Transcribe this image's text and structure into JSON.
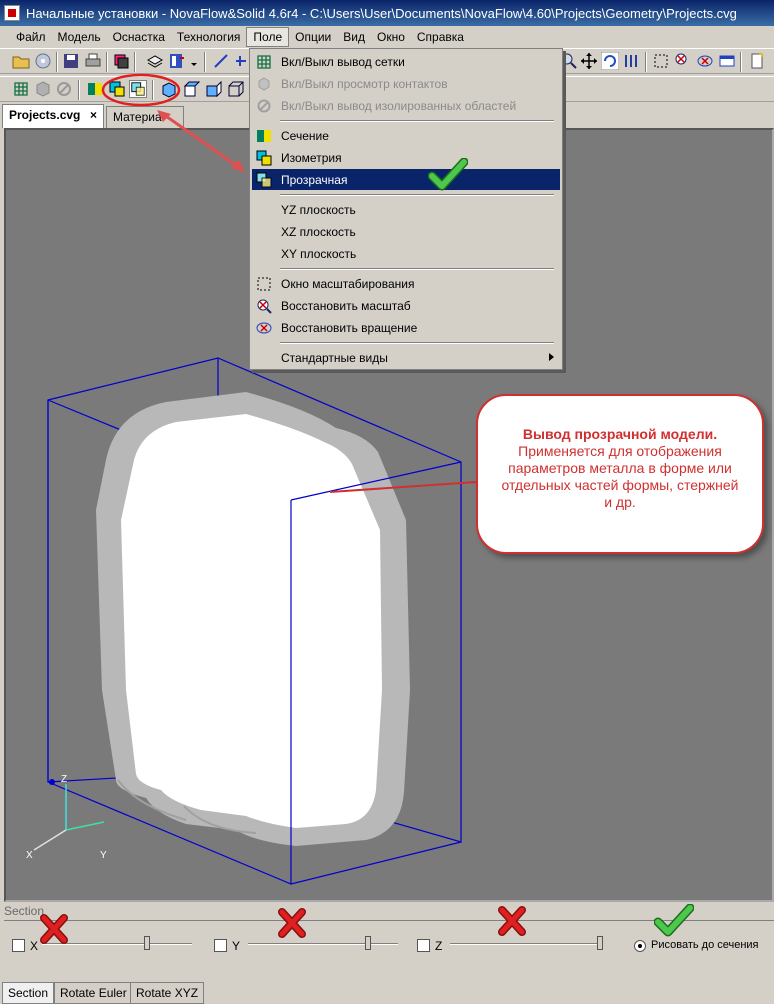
{
  "window": {
    "title": "Начальные установки - NovaFlow&Solid 4.6r4 - C:\\Users\\User\\Documents\\NovaFlow\\4.60\\Projects\\Geometry\\Projects.cvg",
    "title_icon": "app-logo-icon"
  },
  "menubar": {
    "items": [
      "Файл",
      "Модель",
      "Оснастка",
      "Технология",
      "Поле",
      "Опции",
      "Вид",
      "Окно",
      "Справка"
    ],
    "open_item": "Поле"
  },
  "tabs": [
    {
      "label": "Projects.cvg",
      "close": "×"
    },
    {
      "label": "Материа"
    }
  ],
  "dropdown": {
    "items": [
      {
        "label": "Вкл/Выкл вывод сетки",
        "icon": "grid-icon",
        "state": "enabled"
      },
      {
        "label": "Вкл/Выкл просмотр контактов",
        "icon": "contacts-icon",
        "state": "disabled"
      },
      {
        "label": "Вкл/Выкл вывод изолированных областей",
        "icon": "isolated-areas-icon",
        "state": "disabled"
      },
      {
        "label": "Сечение",
        "icon": "section-icon",
        "state": "enabled"
      },
      {
        "label": "Изометрия",
        "icon": "isometry-icon",
        "state": "enabled"
      },
      {
        "label": "Прозрачная",
        "icon": "transparent-icon",
        "state": "selected"
      },
      {
        "label": "YZ плоскость",
        "icon": "",
        "state": "enabled"
      },
      {
        "label": "XZ плоскость",
        "icon": "",
        "state": "enabled"
      },
      {
        "label": "XY плоскость",
        "icon": "",
        "state": "enabled"
      },
      {
        "label": "Окно масштабирования",
        "icon": "zoom-window-icon",
        "state": "enabled"
      },
      {
        "label": "Восстановить масштаб",
        "icon": "restore-zoom-icon",
        "state": "enabled"
      },
      {
        "label": "Восстановить вращение",
        "icon": "restore-rotation-icon",
        "state": "enabled"
      },
      {
        "label": "Стандартные виды",
        "icon": "",
        "state": "submenu"
      }
    ]
  },
  "callout": {
    "title": "Вывод прозрачной модели.",
    "body": "Применяется для отображения параметров металла в форме или отдельных частей формы, стержней и др."
  },
  "axes": {
    "z": "Z",
    "x": "X",
    "y": "Y"
  },
  "section_panel": {
    "label": "Section",
    "x_label": "X",
    "y_label": "Y",
    "z_label": "Z",
    "x_checked": false,
    "y_checked": false,
    "z_checked": false,
    "x_slider_fraction": 0.7,
    "y_slider_fraction": 0.8,
    "z_slider_fraction": 1.0,
    "draw_to_section_label": "Рисовать до сечения",
    "draw_to_section_checked": true
  },
  "bottom_tabs": [
    "Section",
    "Rotate Euler",
    "Rotate XYZ"
  ],
  "colors": {
    "annotation_red": "#d03030",
    "checkmark_green": "#3aa83a",
    "menu_highlight": "#0a246a",
    "bounding_box": "#0000cc",
    "viewport_bg": "#7a7a7a"
  }
}
